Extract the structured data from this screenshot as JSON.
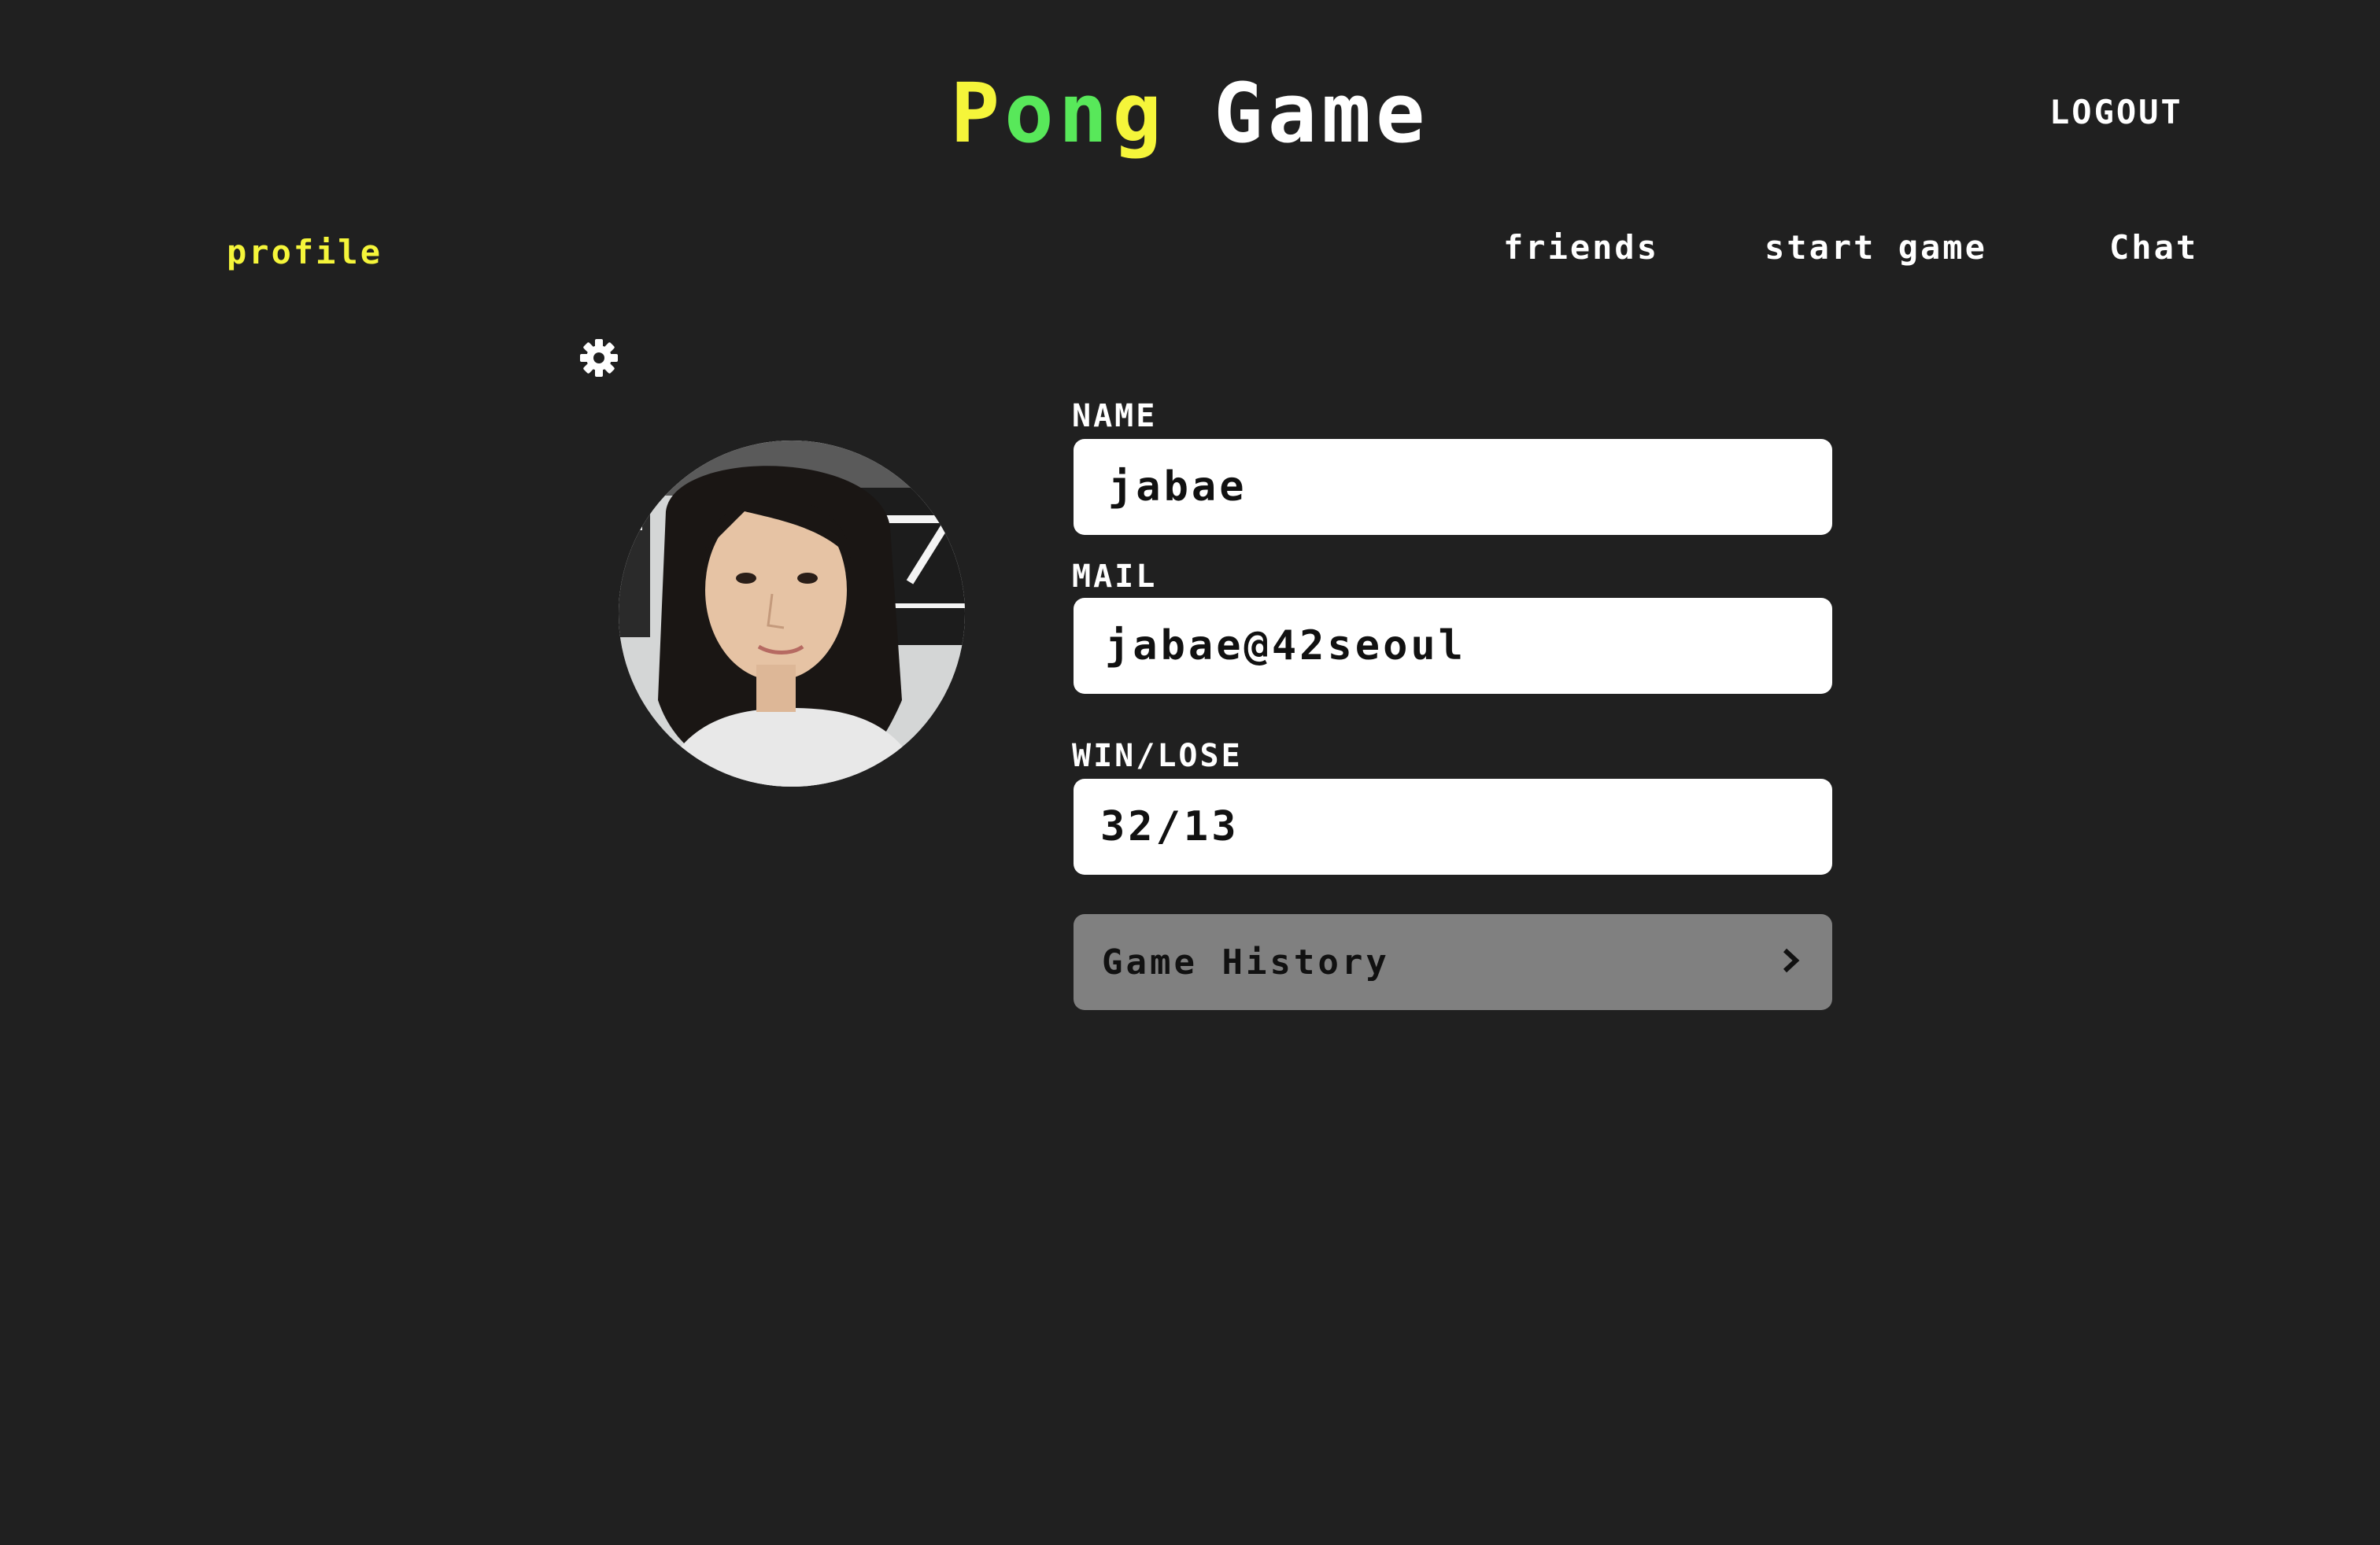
{
  "header": {
    "title_p": "P",
    "title_ong": "on",
    "title_g": "g",
    "title_game": "Game",
    "logout_label": "LOGOUT"
  },
  "nav": {
    "profile": "profile",
    "friends": "friends",
    "start_game": "start game",
    "chat": "Chat"
  },
  "profile": {
    "name_label": "NAME",
    "name_value": "jabae",
    "mail_label": "MAIL",
    "mail_value": "jabae@42seoul",
    "winlose_label": "WIN/LOSE",
    "winlose_value": "32/13",
    "history_button": "Game History"
  },
  "icons": {
    "settings": "gear-icon",
    "history_arrow": "chevron-right-icon"
  },
  "colors": {
    "background": "#202020",
    "accent_yellow": "#f5f53a",
    "accent_green": "#58e85a",
    "field_bg": "#ffffff",
    "button_bg": "#808080"
  }
}
